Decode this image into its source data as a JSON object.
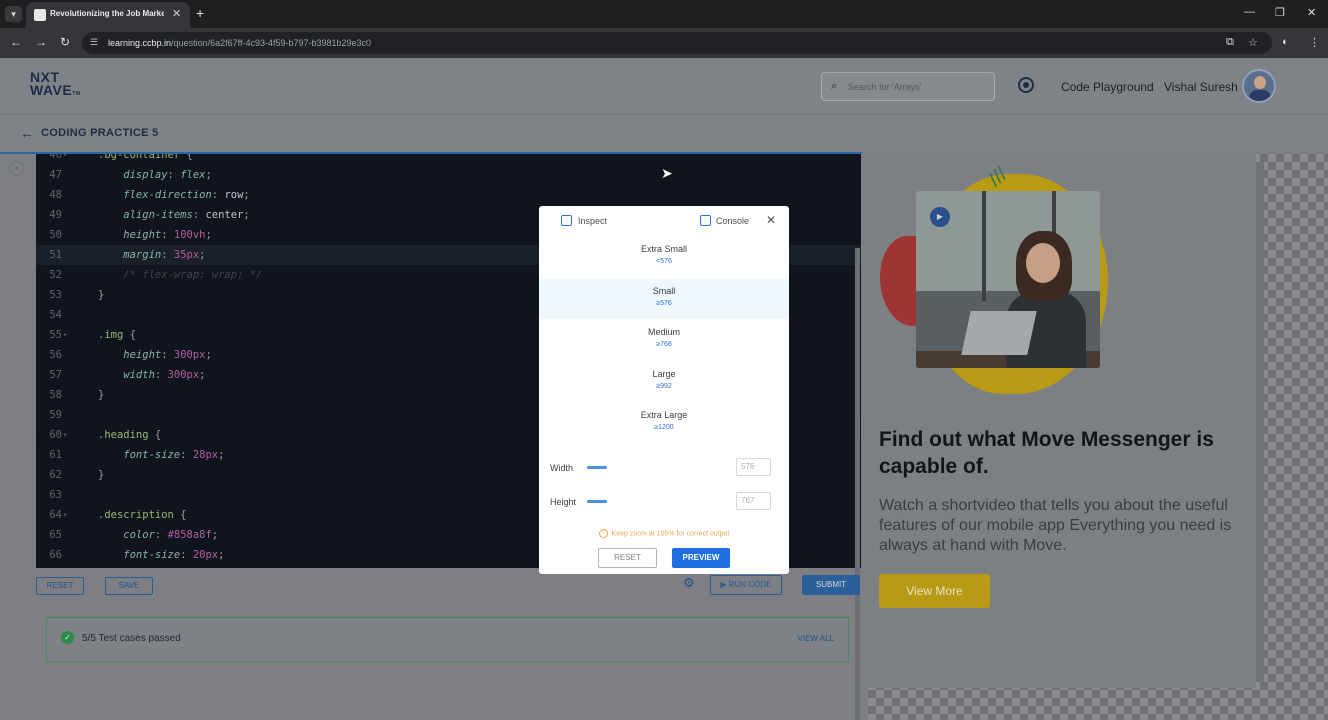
{
  "browser": {
    "tab_title": "Revolutionizing the Job Market",
    "new_tab": "+",
    "url_host": "learning.ccbp.in",
    "url_path": "/question/6a2f67ff-4c93-4f59-b797-b3981b29e3c0"
  },
  "header": {
    "logo_top": "NXT",
    "logo_bottom": "WAVE",
    "logo_tm": "TM",
    "search_placeholder": "Search for 'Arrays'",
    "code_playground": "Code Playground",
    "user_name": "Vishal Suresh"
  },
  "practice": {
    "title": "CODING PRACTICE 5"
  },
  "editor": {
    "lines": [
      {
        "n": "46",
        "fold": true,
        "parts": [
          {
            "t": ".bg-container",
            "c": "sel"
          },
          {
            "t": " {",
            "c": "pun"
          }
        ]
      },
      {
        "n": "47",
        "parts": [
          {
            "t": "    display",
            "c": "prop"
          },
          {
            "t": ": ",
            "c": "pun"
          },
          {
            "t": "flex",
            "c": "prop"
          },
          {
            "t": ";",
            "c": "pun"
          }
        ]
      },
      {
        "n": "48",
        "parts": [
          {
            "t": "    flex-direction",
            "c": "prop"
          },
          {
            "t": ": ",
            "c": "pun"
          },
          {
            "t": "row",
            "c": "val"
          },
          {
            "t": ";",
            "c": "pun"
          }
        ]
      },
      {
        "n": "49",
        "parts": [
          {
            "t": "    align-items",
            "c": "prop"
          },
          {
            "t": ": ",
            "c": "pun"
          },
          {
            "t": "center",
            "c": "val"
          },
          {
            "t": ";",
            "c": "pun"
          }
        ]
      },
      {
        "n": "50",
        "parts": [
          {
            "t": "    height",
            "c": "prop"
          },
          {
            "t": ": ",
            "c": "pun"
          },
          {
            "t": "100vh",
            "c": "num"
          },
          {
            "t": ";",
            "c": "pun"
          }
        ]
      },
      {
        "n": "51",
        "cur": true,
        "parts": [
          {
            "t": "    margin",
            "c": "prop"
          },
          {
            "t": ": ",
            "c": "pun"
          },
          {
            "t": "35px",
            "c": "num"
          },
          {
            "t": ";",
            "c": "pun"
          }
        ]
      },
      {
        "n": "52",
        "parts": [
          {
            "t": "    /* flex-wrap: wrap; */",
            "c": "cmt"
          }
        ]
      },
      {
        "n": "53",
        "parts": [
          {
            "t": "}",
            "c": "pun"
          }
        ]
      },
      {
        "n": "54",
        "parts": []
      },
      {
        "n": "55",
        "fold": true,
        "parts": [
          {
            "t": ".img",
            "c": "sel"
          },
          {
            "t": " {",
            "c": "pun"
          }
        ]
      },
      {
        "n": "56",
        "parts": [
          {
            "t": "    height",
            "c": "prop"
          },
          {
            "t": ": ",
            "c": "pun"
          },
          {
            "t": "300px",
            "c": "num"
          },
          {
            "t": ";",
            "c": "pun"
          }
        ]
      },
      {
        "n": "57",
        "parts": [
          {
            "t": "    width",
            "c": "prop"
          },
          {
            "t": ": ",
            "c": "pun"
          },
          {
            "t": "300px",
            "c": "num"
          },
          {
            "t": ";",
            "c": "pun"
          }
        ]
      },
      {
        "n": "58",
        "parts": [
          {
            "t": "}",
            "c": "pun"
          }
        ]
      },
      {
        "n": "59",
        "parts": []
      },
      {
        "n": "60",
        "fold": true,
        "parts": [
          {
            "t": ".heading",
            "c": "sel"
          },
          {
            "t": " {",
            "c": "pun"
          }
        ]
      },
      {
        "n": "61",
        "parts": [
          {
            "t": "    font-size",
            "c": "prop"
          },
          {
            "t": ": ",
            "c": "pun"
          },
          {
            "t": "28px",
            "c": "num"
          },
          {
            "t": ";",
            "c": "pun"
          }
        ]
      },
      {
        "n": "62",
        "parts": [
          {
            "t": "}",
            "c": "pun"
          }
        ]
      },
      {
        "n": "63",
        "parts": []
      },
      {
        "n": "64",
        "fold": true,
        "parts": [
          {
            "t": ".description",
            "c": "sel"
          },
          {
            "t": " {",
            "c": "pun"
          }
        ]
      },
      {
        "n": "65",
        "parts": [
          {
            "t": "    color",
            "c": "prop"
          },
          {
            "t": ": ",
            "c": "pun"
          },
          {
            "t": "#858a8f",
            "c": "num"
          },
          {
            "t": ";",
            "c": "pun"
          }
        ]
      },
      {
        "n": "66",
        "parts": [
          {
            "t": "    font-size",
            "c": "prop"
          },
          {
            "t": ": ",
            "c": "pun"
          },
          {
            "t": "20px",
            "c": "num"
          },
          {
            "t": ";",
            "c": "pun"
          }
        ]
      }
    ]
  },
  "actions": {
    "reset": "RESET",
    "save": "SAVE",
    "run_code": "RUN CODE",
    "submit": "SUBMIT"
  },
  "tests": {
    "status": "5/5 Test cases passed",
    "view_all": "VIEW ALL"
  },
  "preview_page": {
    "heading": "Find out what Move Messenger is capable of.",
    "description": "Watch a shortvideo that tells you about the useful features of our mobile app Everything you need is always at hand with Move.",
    "button": "View More"
  },
  "dialog": {
    "inspect": "Inspect",
    "console": "Console",
    "breakpoints": [
      {
        "name": "Extra Small",
        "value": "<576",
        "active": false
      },
      {
        "name": "Small",
        "value": "≥576",
        "active": true
      },
      {
        "name": "Medium",
        "value": "≥768",
        "active": false
      },
      {
        "name": "Large",
        "value": "≥992",
        "active": false
      },
      {
        "name": "Extra Large",
        "value": "≥1200",
        "active": false
      }
    ],
    "width_label": "Width",
    "width_value": "576",
    "height_label": "Height",
    "height_value": "767",
    "note": "Keep zoom at 100% for correct output",
    "reset": "RESET",
    "preview": "PREVIEW"
  }
}
